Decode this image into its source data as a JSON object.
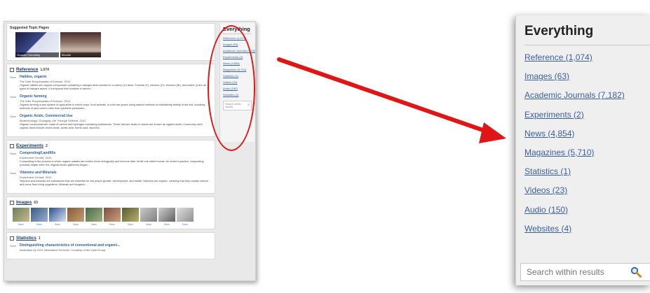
{
  "thumbnail": {
    "topic_pages_title": "Suggested Topic Pages",
    "topics": [
      {
        "label": "Organic Chemistry"
      },
      {
        "label": "Biocide"
      }
    ],
    "reference": {
      "label": "Reference",
      "count": "1,074",
      "items": [
        {
          "save": "Save",
          "title": "Halides, organic",
          "source": "The Gale Encyclopedia of Science, 2014",
          "text": "Organic halides are organic compounds containing a halogen atom bonded to a carbon (C) atom. Fluorine (F), chlorine (Cl), bromine (Br), and iodine (I) are all types of halogen atoms. A compound that contains a carbon..."
        },
        {
          "save": "Save",
          "title": "Organic farming",
          "source": "The Gale Encyclopedia of Science, 2014",
          "text": "Organic farming is any system of agriculture in which crops, food animals, or both are grown using natural methods of maintaining fertility of the soil, including methods of pest control other than synthetic pesticides..."
        },
        {
          "save": "Save",
          "title": "Organic Acids, Commercial Use",
          "source": "Biotechnology: Changing Life Through Science, 2012",
          "text": "Organic compounds are made of carbon and hydrogen containing substances. Those that are acidic in nature are known as organic acids. Commonly used organic acids include amino acids, acetic acid, formic acid, ascorbic..."
        }
      ]
    },
    "experiments": {
      "label": "Experiments",
      "count": "2",
      "items": [
        {
          "save": "Save",
          "title": "Composting/Landfills",
          "source": "Experiment Central, 2010",
          "text": "Composting is the process in which organic wastes are broken down biologically and become dark, fertile soil called humus. An ancient practice, composting probably began when the original hunter-gatherers began..."
        },
        {
          "save": "Save",
          "title": "Vitamins and Minerals",
          "source": "Experiment Central, 2010",
          "text": "Vitamins and minerals are substances that are essential for the proper growth, development, and health. Vitamins are organic, meaning that they contain carbon and come from living organisms. Minerals are inorganic..."
        }
      ]
    },
    "images": {
      "label": "Images",
      "count": "63",
      "save_labels": [
        "Save",
        "Save",
        "Save",
        "Save",
        "Save",
        "Save",
        "Save",
        "Save",
        "Save",
        "Save"
      ]
    },
    "statistics": {
      "label": "Statistics",
      "count": "1",
      "items": [
        {
          "save": "Save",
          "title": "Distinguishing characteristics of conventional and organic...",
          "source": "Illustration by GGS Information Services. Courtesy of the Gale Group."
        }
      ]
    },
    "sidebar": {
      "title": "Everything",
      "links": [
        "Reference (1,074)",
        "Images (63)",
        "Academic Journals (7,182)",
        "Experiments (2)",
        "News (4,854)",
        "Magazines (5,710)",
        "Statistics (1)",
        "Videos (23)",
        "Audio (150)",
        "Websites (4)"
      ],
      "search_placeholder": "Search within results"
    }
  },
  "zoomed": {
    "title": "Everything",
    "links": [
      "Reference (1,074)",
      "Images (63)",
      "Academic Journals (7,182)",
      "Experiments (2)",
      "News (4,854)",
      "Magazines (5,710)",
      "Statistics (1)",
      "Videos (23)",
      "Audio (150)",
      "Websites (4)"
    ],
    "search_placeholder": "Search within results"
  },
  "colors": {
    "highlight_ellipse": "#e01515",
    "arrow": "#e01515",
    "link": "#3a5f9e"
  },
  "icons": {
    "search": "magnifier-icon",
    "reference": "book-icon",
    "experiments": "flask-icon",
    "images": "image-icon",
    "statistics": "chart-icon"
  }
}
